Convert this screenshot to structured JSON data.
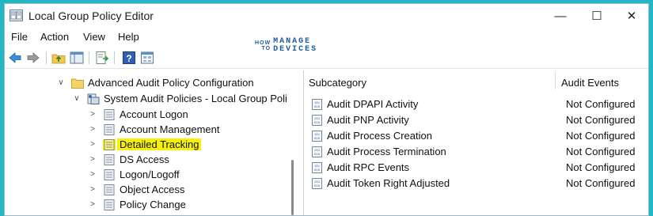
{
  "window": {
    "title": "Local Group Policy Editor",
    "controls": {
      "minimize": "—",
      "maximize": "☐",
      "close": "✕"
    }
  },
  "menu": [
    "File",
    "Action",
    "View",
    "Help"
  ],
  "watermark": {
    "how": "HOW",
    "to": "TO",
    "manage": "MANAGE",
    "devices": "DEVICES"
  },
  "toolbar": [
    "back-arrow-icon",
    "forward-arrow-icon",
    "up-folder-icon",
    "show-hide-tree-icon",
    "export-list-icon",
    "help-icon",
    "properties-icon"
  ],
  "tree": [
    {
      "label": "Advanced Audit Policy Configuration",
      "level": 0,
      "expanded": true
    },
    {
      "label": "System Audit Policies - Local Group Poli",
      "level": 1,
      "expanded": true
    },
    {
      "label": "Account Logon",
      "level": 2
    },
    {
      "label": "Account Management",
      "level": 2
    },
    {
      "label": "Detailed Tracking",
      "level": 2,
      "selected": true
    },
    {
      "label": "DS Access",
      "level": 2
    },
    {
      "label": "Logon/Logoff",
      "level": 2
    },
    {
      "label": "Object Access",
      "level": 2
    },
    {
      "label": "Policy Change",
      "level": 2
    }
  ],
  "list": {
    "columns": [
      "Subcategory",
      "Audit Events"
    ],
    "rows": [
      {
        "subcategory": "Audit DPAPI Activity",
        "audit_events": "Not Configured"
      },
      {
        "subcategory": "Audit PNP Activity",
        "audit_events": "Not Configured"
      },
      {
        "subcategory": "Audit Process Creation",
        "audit_events": "Not Configured"
      },
      {
        "subcategory": "Audit Process Termination",
        "audit_events": "Not Configured"
      },
      {
        "subcategory": "Audit RPC Events",
        "audit_events": "Not Configured"
      },
      {
        "subcategory": "Audit Token Right Adjusted",
        "audit_events": "Not Configured"
      }
    ]
  },
  "colors": {
    "background": "#22b7c3",
    "highlight": "#f6f10a",
    "watermark": "#1e5a9e"
  }
}
